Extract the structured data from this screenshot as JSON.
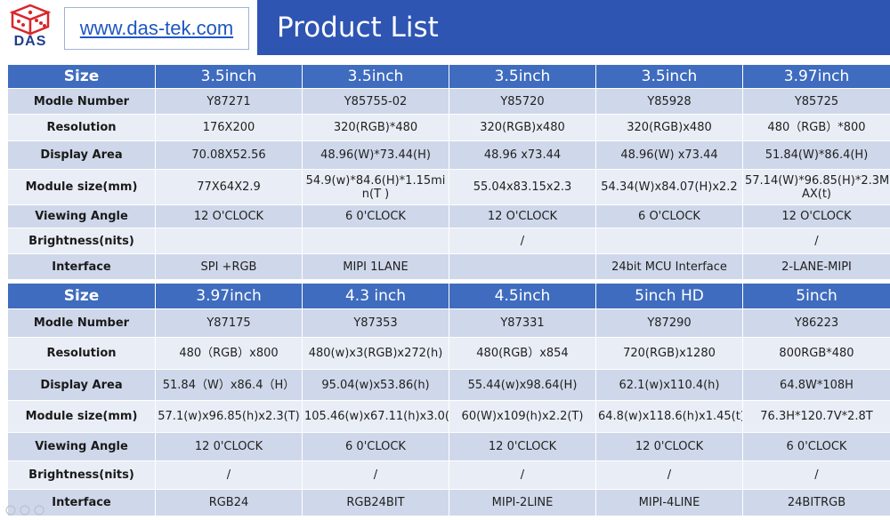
{
  "header": {
    "logo_text": "DAS",
    "url": "www.das-tek.com",
    "title": "Product List"
  },
  "table1": {
    "size_label": "Size",
    "sizes": [
      "3.5inch",
      "3.5inch",
      "3.5inch",
      "3.5inch",
      "3.97inch"
    ],
    "rows": [
      {
        "label": "Modle Number",
        "values": [
          "Y87271",
          "Y85755-02",
          "Y85720",
          "Y85928",
          "Y85725"
        ]
      },
      {
        "label": "Resolution",
        "values": [
          "176X200",
          "320(RGB)*480",
          "320(RGB)x480",
          "320(RGB)x480",
          "480（RGB）*800"
        ]
      },
      {
        "label": "Display Area",
        "values": [
          "70.08X52.56",
          "48.96(W)*73.44(H)",
          "48.96 x73.44",
          "48.96(W) x73.44",
          "51.84(W)*86.4(H)"
        ]
      },
      {
        "label": "Module size(mm)",
        "values": [
          "77X64X2.9",
          "54.9(w)*84.6(H)*1.15mi n(T )",
          "55.04x83.15x2.3",
          "54.34(W)x84.07(H)x2.2",
          "57.14(W)*96.85(H)*2.3M AX(t)"
        ]
      },
      {
        "label": "Viewing Angle",
        "values": [
          "12 O'CLOCK",
          "6 0'CLOCK",
          "12 O'CLOCK",
          "6 O'CLOCK",
          "12 O'CLOCK"
        ]
      },
      {
        "label": "Brightness(nits)",
        "values": [
          "",
          "",
          "/",
          "",
          "/"
        ]
      },
      {
        "label": "Interface",
        "values": [
          "SPI +RGB",
          "MIPI 1LANE",
          "",
          "24bit MCU Interface",
          "2-LANE-MIPI"
        ]
      }
    ]
  },
  "table2": {
    "size_label": "Size",
    "sizes": [
      "3.97inch",
      "4.3 inch",
      "4.5inch",
      "5inch HD",
      "5inch"
    ],
    "rows": [
      {
        "label": "Modle Number",
        "values": [
          "Y87175",
          "Y87353",
          "Y87331",
          "Y87290",
          "Y86223"
        ]
      },
      {
        "label": "Resolution",
        "values": [
          "480（RGB）x800",
          "480(w)x3(RGB)x272(h)",
          "480(RGB）x854",
          "720(RGB)x1280",
          "800RGB*480"
        ]
      },
      {
        "label": "Display Area",
        "values": [
          "51.84（W）x86.4（H）",
          "95.04(w)x53.86(h)",
          "55.44(w)x98.64(H)",
          "62.1(w)x110.4(h)",
          "64.8W*108H"
        ]
      },
      {
        "label": "Module size(mm)",
        "values": [
          "57.1(w)x96.85(h)x2.3(T)",
          "105.46(w)x67.11(h)x3.0(t)",
          "60(W)x109(h)x2.2(T)",
          "64.8(w)x118.6(h)x1.45(t)",
          "76.3H*120.7V*2.8T"
        ]
      },
      {
        "label": "Viewing Angle",
        "values": [
          "12 0'CLOCK",
          "6 0'CLOCK",
          "12 0'CLOCK",
          "12 0'CLOCK",
          "6 0'CLOCK"
        ]
      },
      {
        "label": "Brightness(nits)",
        "values": [
          "/",
          "/",
          "/",
          "/",
          "/"
        ]
      },
      {
        "label": "Interface",
        "values": [
          "RGB24",
          "RGB24BIT",
          "MIPI-2LINE",
          "MIPI-4LINE",
          "24BITRGB"
        ]
      }
    ]
  },
  "colors": {
    "header_blue": "#2f55b3",
    "table_header_blue": "#3f6cbe",
    "row_dark": "#cfd8ea",
    "row_light": "#e9edf5",
    "url_blue": "#1f56c2",
    "logo_red": "#d9262b"
  }
}
